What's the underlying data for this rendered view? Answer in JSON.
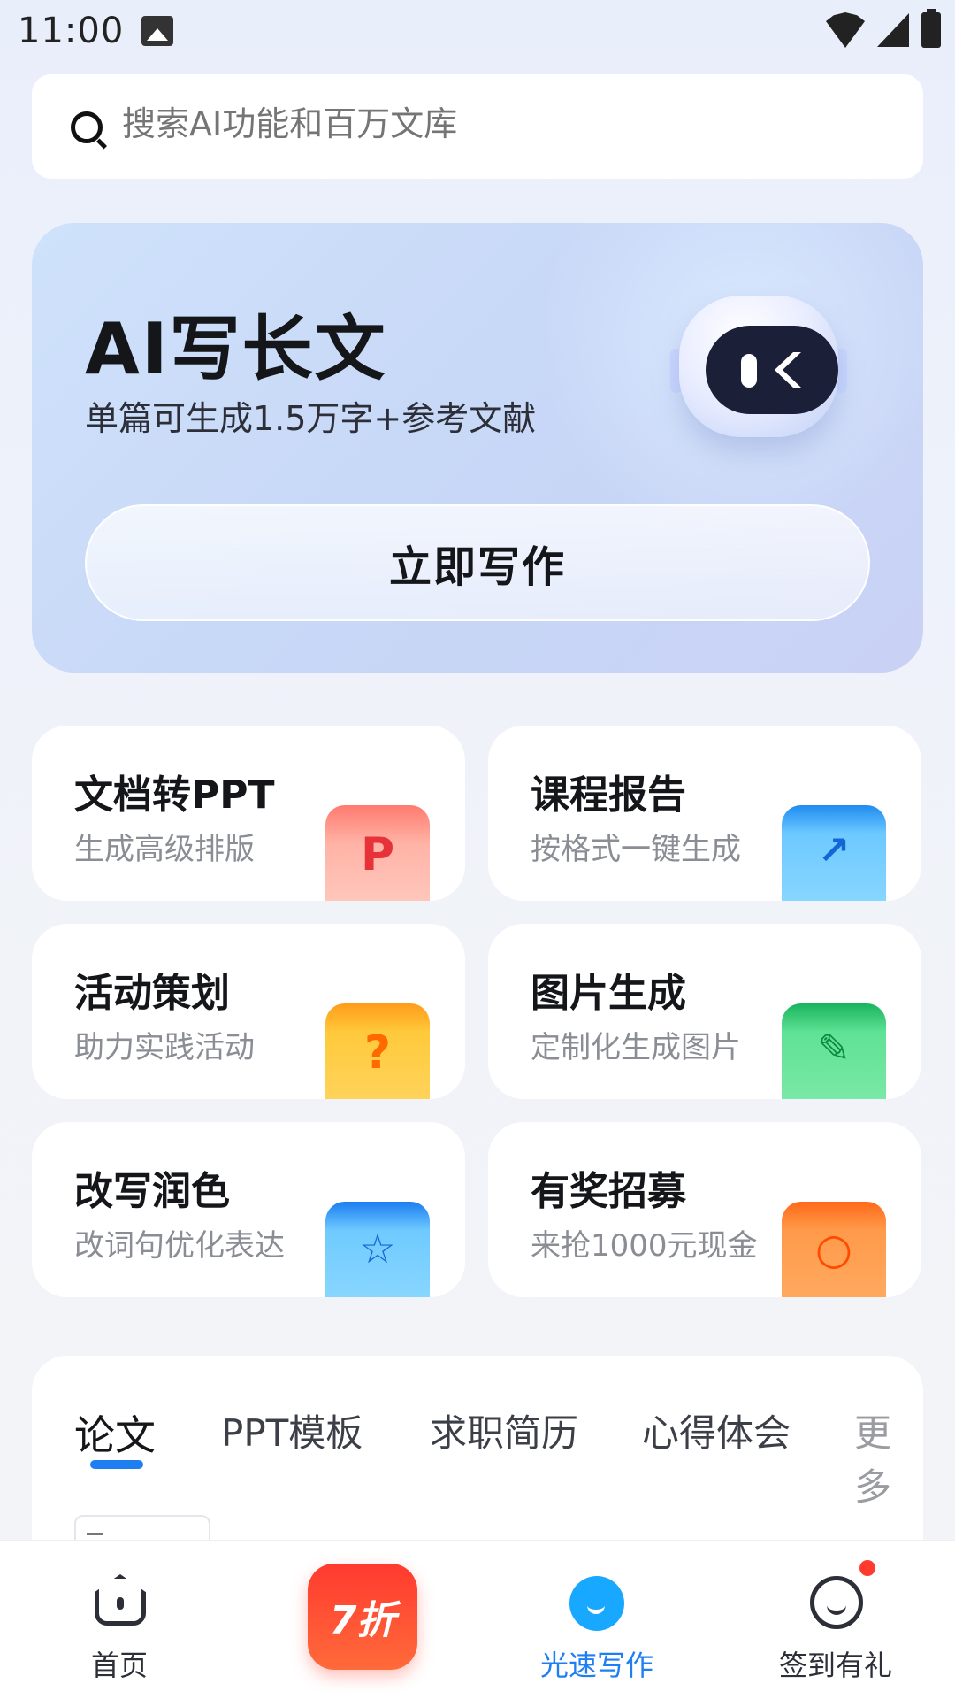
{
  "status_bar": {
    "time": "11:00"
  },
  "search": {
    "placeholder": "搜索AI功能和百万文库"
  },
  "hero": {
    "title": "AI写长文",
    "subtitle": "单篇可生成1.5万字+参考文献",
    "button_label": "立即写作"
  },
  "features": [
    {
      "title": "文档转PPT",
      "subtitle": "生成高级排版",
      "icon": "ppt-icon"
    },
    {
      "title": "课程报告",
      "subtitle": "按格式一键生成",
      "icon": "report-folder-icon"
    },
    {
      "title": "活动策划",
      "subtitle": "助力实践活动",
      "icon": "plan-book-icon"
    },
    {
      "title": "图片生成",
      "subtitle": "定制化生成图片",
      "icon": "paint-brush-icon"
    },
    {
      "title": "改写润色",
      "subtitle": "改词句优化表达",
      "icon": "rewrite-book-icon"
    },
    {
      "title": "有奖招募",
      "subtitle": "来抢1000元现金",
      "icon": "gift-box-icon"
    }
  ],
  "tabs": [
    "论文",
    "PPT模板",
    "求职简历",
    "心得体会",
    "更多"
  ],
  "bottom_nav": {
    "home": "首页",
    "promo": "7折",
    "speed_write": "光速写作",
    "checkin": "签到有礼"
  },
  "colors": {
    "accent": "#1f7ff2"
  }
}
